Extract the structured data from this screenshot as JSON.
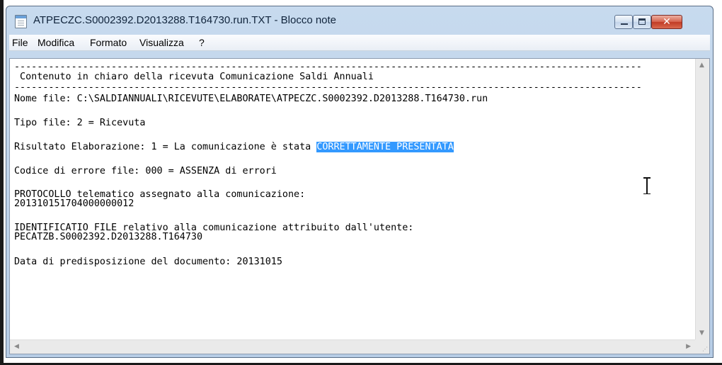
{
  "window": {
    "title": "ATPECZC.S0002392.D2013288.T164730.run.TXT - Blocco note",
    "icon": "notepad-icon",
    "controls": {
      "minimize": "minimize-icon",
      "maximize": "maximize-icon",
      "close": "✕"
    }
  },
  "menu": {
    "items": [
      "File",
      "Modifica",
      "Formato",
      "Visualizza",
      "?"
    ]
  },
  "document": {
    "lines": [
      "--------------------------------------------------------------------------------------------------------------",
      " Contenuto in chiaro della ricevuta Comunicazione Saldi Annuali",
      "--------------------------------------------------------------------------------------------------------------",
      "Nome file: C:\\SALDIANNUALI\\RICEVUTE\\ELABORATE\\ATPECZC.S0002392.D2013288.T164730.run",
      "Tipo file: 2 = Ricevuta",
      "Risultato Elaborazione: 1 = La comunicazione è stata ",
      "Codice di errore file: 000 = ASSENZA di errori",
      "PROTOCOLLO telematico assegnato alla comunicazione:",
      "201310151704000000012",
      "IDENTIFICATIO FILE relativo alla comunicazione attribuito dall'utente:",
      "PECATZB.S0002392.D2013288.T164730",
      "Data di predisposizione del documento: 20131015"
    ],
    "selected_text": "CORRETTAMENTE PRESENTATA"
  },
  "colors": {
    "selection": "#3399ff",
    "titlebar": "#c7daee",
    "close_button": "#c13b25"
  },
  "scrollbars": {
    "up_arrow": "▲",
    "down_arrow": "▼",
    "left_arrow": "◀",
    "right_arrow": "▶",
    "grip": "⋰"
  }
}
